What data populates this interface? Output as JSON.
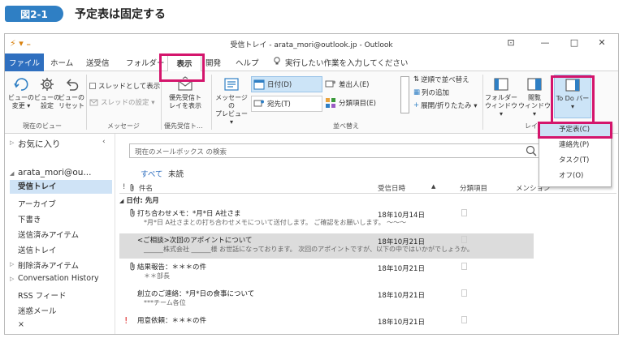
{
  "figure": {
    "badge": "図2-1",
    "title": "予定表は固定する"
  },
  "window": {
    "title": "受信トレイ - arata_mori@outlook.jp  -  Outlook",
    "quick_access": "⚡ ▾ ₌",
    "controls": {
      "ribbon_display": "⊡",
      "minimize": "—",
      "maximize": "□",
      "close": "✕"
    }
  },
  "tabs": [
    "ファイル",
    "ホーム",
    "送受信",
    "フォルダー",
    "表示",
    "開発",
    "ヘルプ"
  ],
  "tell_me": "実行したい作業を入力してください",
  "ribbon": {
    "current_view": {
      "change_view": [
        "ビューの",
        "変更 ▾"
      ],
      "view_settings": [
        "ビューの",
        "設定"
      ],
      "reset_view": [
        "ビューの",
        "リセット"
      ],
      "label": "現在のビュー"
    },
    "messages": {
      "show_as_threads": "スレッドとして表示",
      "thread_settings": "スレッドの設定 ▾",
      "label": "メッセージ"
    },
    "priority_inbox": {
      "button": [
        "優先受信ト",
        "レイを表示"
      ],
      "label": "優先受信ト..."
    },
    "arrangement": {
      "message_preview": [
        "メッセージの",
        "プレビュー ▾"
      ],
      "date": "日付(D)",
      "from": "差出人(E)",
      "to": "宛先(T)",
      "categories": "分類項目(E)",
      "reverse_sort": "逆順で並べ替え",
      "add_column": "列の追加",
      "expand_collapse": "展開/折りたたみ ▾",
      "label": "並べ替え"
    },
    "layout": {
      "folder_pane": [
        "フォルダー",
        "ウィンドウ ▾"
      ],
      "reading_pane": [
        "閲覧",
        "ウィンドウ ▾"
      ],
      "todo_bar": [
        "To Do バー",
        "▾"
      ],
      "label": "レイア"
    }
  },
  "todo_menu": [
    "予定表(C)",
    "連絡先(P)",
    "タスク(T)",
    "オフ(O)"
  ],
  "sidebar": {
    "favorites": "お気に入り",
    "account": "arata_mori@ou...",
    "folders": [
      "受信トレイ",
      "アーカイブ",
      "下書き",
      "送信済みアイテム",
      "送信トレイ",
      "削除済みアイテム",
      "Conversation History",
      "RSS フィード",
      "迷惑メール",
      "×"
    ]
  },
  "main": {
    "search_placeholder": "現在のメールボックス の検索",
    "filter_all": "すべて",
    "filter_unread": "未読",
    "columns": {
      "icons": "!",
      "subject": "件名",
      "received": "受信日時",
      "categories": "分類項目",
      "mentions": "メンション"
    },
    "group": "日付: 先月",
    "emails": [
      {
        "subject": "打ち合わせメモ：*月*日 A社さま",
        "preview": "*月*日 A社さまとの打ち合わせメモについて送付します。 ご確認をお願いします。 〜〜〜",
        "date": "18年10月14日"
      },
      {
        "subject": "<ご相談>次回のアポイントについて",
        "preview": "______株式会社 ______様 お世話になっております。 次回のアポイントですが、以下の中ではいかがでしょうか。",
        "date": "18年10月21日"
      },
      {
        "subject": "結果報告：＊＊＊の件",
        "preview": "＊＊部長",
        "date": "18年10月21日"
      },
      {
        "subject": "創立のご連絡：*月*日の食事について",
        "preview": "***チーム各位",
        "date": "18年10月21日"
      },
      {
        "subject": "用意依頼：＊＊＊の件",
        "preview": "",
        "date": "18年10月21日"
      }
    ]
  },
  "colors": {
    "accent": "#2f6fbf",
    "highlight": "#d4156c",
    "selected": "#cfe3f6"
  }
}
